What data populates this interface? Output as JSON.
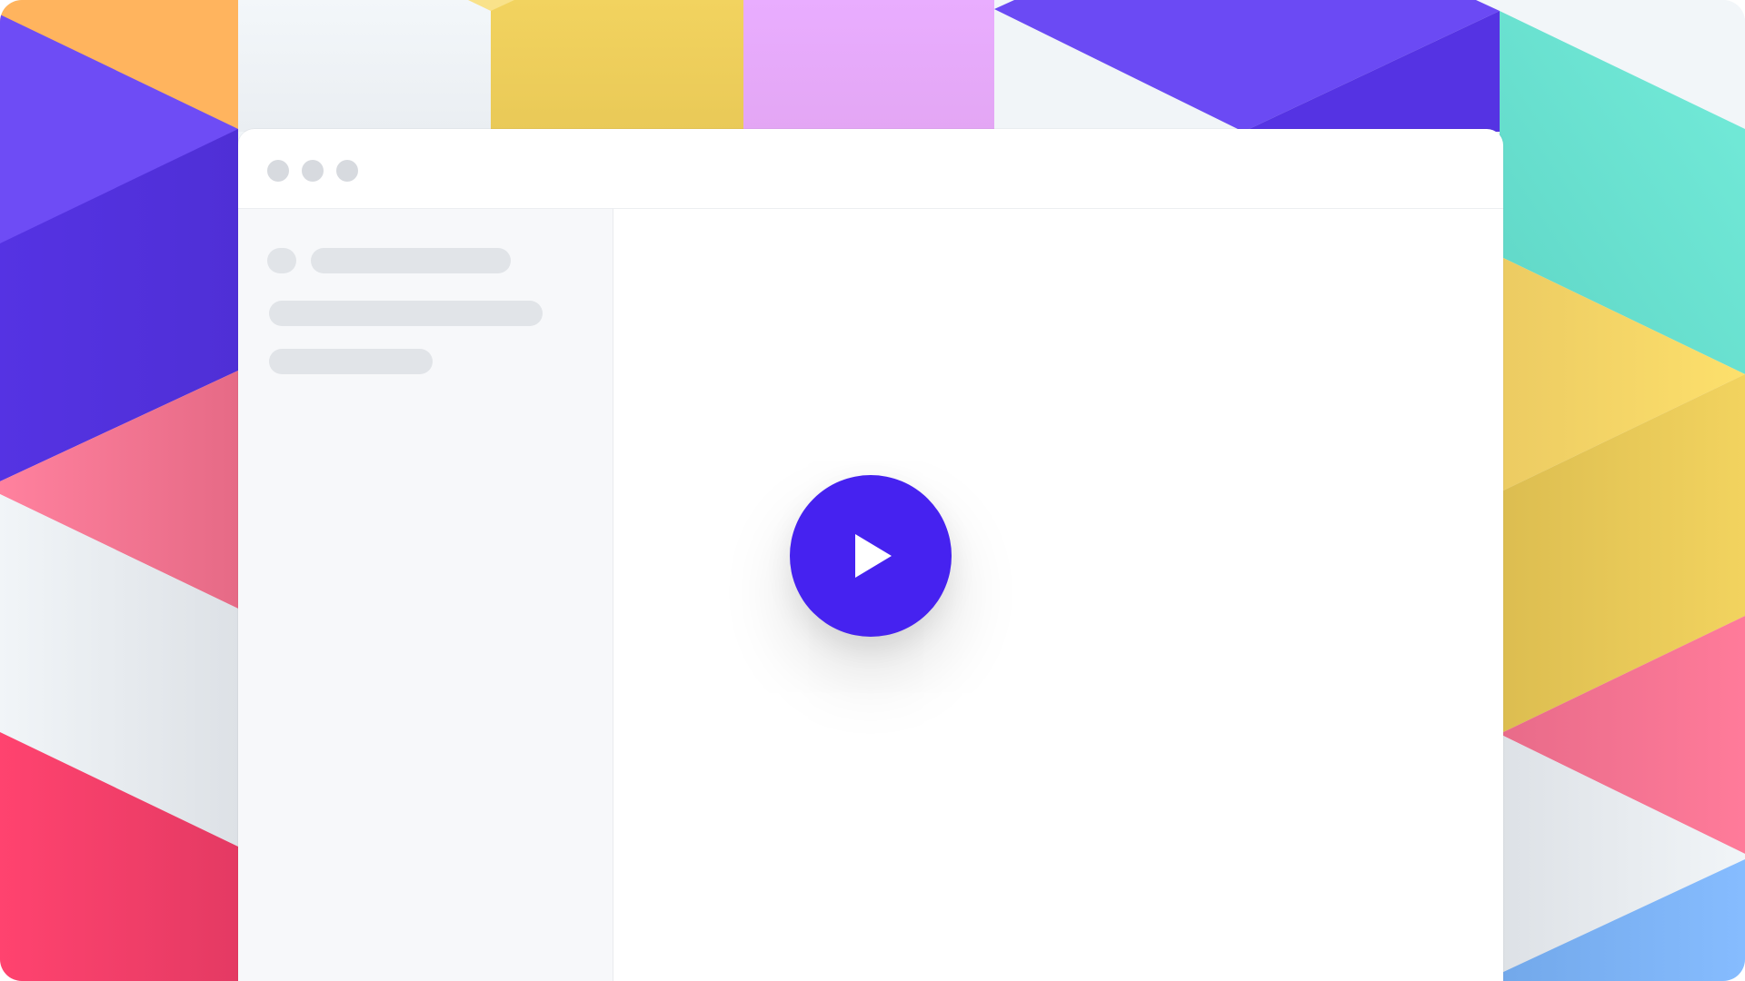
{
  "colors": {
    "accent": "#4622f0",
    "violet": "#6e4cf5",
    "deep_violet": "#5533e3",
    "orange": "#ffb45e",
    "yellow": "#f2d35f",
    "lilac": "#e9adff",
    "teal": "#72e9d8",
    "pink": "#ff7b9a",
    "red_pink": "#ff436f",
    "sky": "#86bcff",
    "pale": "#f1f5f8"
  },
  "window": {
    "controls": [
      "window-dot-icon",
      "window-dot-icon",
      "window-dot-icon"
    ]
  },
  "player": {
    "icon": "play-icon"
  }
}
